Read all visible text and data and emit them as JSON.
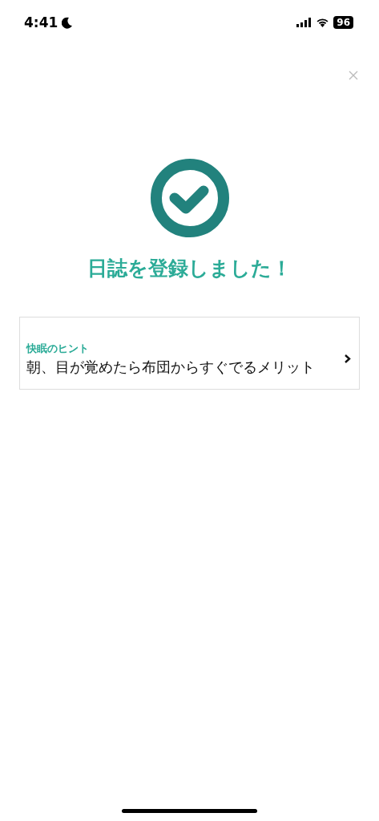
{
  "status_bar": {
    "time": "4:41",
    "battery": "96"
  },
  "title": "日誌を登録しました！",
  "hint_card": {
    "label": "快眠のヒント",
    "text": "朝、目が覚めたら布団からすぐでるメリット"
  }
}
